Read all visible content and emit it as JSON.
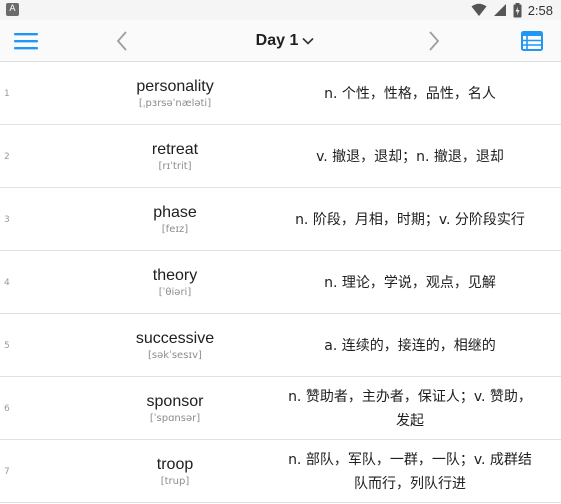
{
  "status_bar": {
    "app_icon_letter": "A",
    "time": "2:58"
  },
  "toolbar": {
    "title": "Day 1",
    "icons": {
      "menu": "hamburger-icon",
      "prev": "chevron-left-icon",
      "next": "chevron-right-icon",
      "dropdown": "chevron-down-icon",
      "list": "list-view-icon"
    }
  },
  "colors": {
    "accent": "#2196f3",
    "divider": "#e2e2e2",
    "phonetic": "#8c8c8c"
  },
  "words": [
    {
      "index": "1",
      "word": "personality",
      "phonetic": "[ˌpɜrsəˈnæləti]",
      "meaning": "n. 个性，性格，品性，名人"
    },
    {
      "index": "2",
      "word": "retreat",
      "phonetic": "[rɪˈtrit]",
      "meaning": "v. 撤退，退却；n. 撤退，退却"
    },
    {
      "index": "3",
      "word": "phase",
      "phonetic": "[feɪz]",
      "meaning": "n. 阶段，月相，时期；v. 分阶段实行"
    },
    {
      "index": "4",
      "word": "theory",
      "phonetic": "[ˈθiəri]",
      "meaning": "n. 理论，学说，观点，见解"
    },
    {
      "index": "5",
      "word": "successive",
      "phonetic": "[səkˈsesɪv]",
      "meaning": "a. 连续的，接连的，相继的"
    },
    {
      "index": "6",
      "word": "sponsor",
      "phonetic": "[ˈspɑnsər]",
      "meaning": "n. 赞助者，主办者，保证人；v. 赞助，发起"
    },
    {
      "index": "7",
      "word": "troop",
      "phonetic": "[trup]",
      "meaning": "n. 部队，军队，一群，一队；v. 成群结队而行，列队行进"
    }
  ]
}
